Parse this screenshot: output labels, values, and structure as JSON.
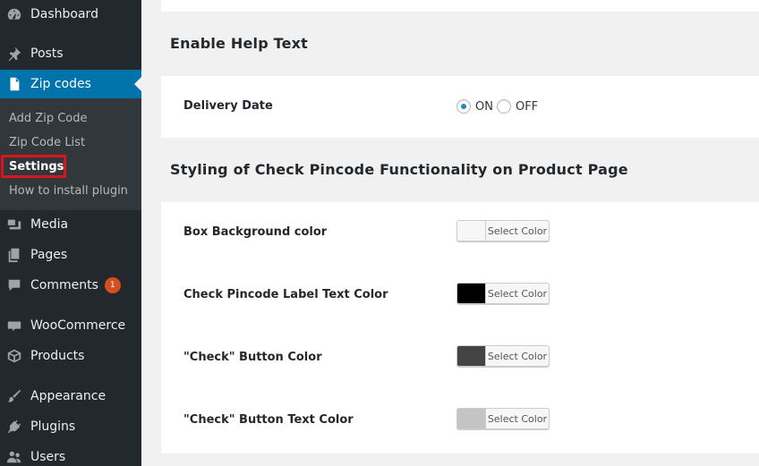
{
  "sidebar": {
    "menu": [
      {
        "label": "Dashboard",
        "icon": "dashboard-icon"
      },
      {
        "label": "Posts",
        "icon": "pin-icon"
      },
      {
        "label": "Zip codes",
        "icon": "document-icon"
      },
      {
        "label": "Media",
        "icon": "media-icon"
      },
      {
        "label": "Pages",
        "icon": "pages-icon"
      },
      {
        "label": "Comments",
        "icon": "comment-icon",
        "badge": "1"
      },
      {
        "label": "WooCommerce",
        "icon": "woo-icon"
      },
      {
        "label": "Products",
        "icon": "box-icon"
      },
      {
        "label": "Appearance",
        "icon": "brush-icon"
      },
      {
        "label": "Plugins",
        "icon": "plug-icon"
      },
      {
        "label": "Users",
        "icon": "users-icon"
      }
    ],
    "submenu": [
      {
        "label": "Add Zip Code"
      },
      {
        "label": "Zip Code List"
      },
      {
        "label": "Settings"
      },
      {
        "label": "How to install plugin"
      }
    ],
    "colors": {
      "bg": "#23282d",
      "submenu_bg": "#32373c",
      "current": "#0073aa",
      "highlight": "#d9141c",
      "badge": "#d54e21"
    }
  },
  "main": {
    "help_section": {
      "title": "Enable Help Text",
      "delivery_label": "Delivery Date",
      "on_label": "ON",
      "off_label": "OFF",
      "selected": "ON"
    },
    "styling_section": {
      "title": "Styling of Check Pincode Functionality on Product Page",
      "fields": [
        {
          "label": "Box Background color",
          "button": "Select Color",
          "color": "#f7f7f7"
        },
        {
          "label": "Check Pincode Label Text Color",
          "button": "Select Color",
          "color": "#000000"
        },
        {
          "label": "\"Check\" Button Color",
          "button": "Select Color",
          "color": "#444444"
        },
        {
          "label": "\"Check\" Button Text Color",
          "button": "Select Color",
          "color": "#c4c4c4"
        }
      ]
    }
  }
}
